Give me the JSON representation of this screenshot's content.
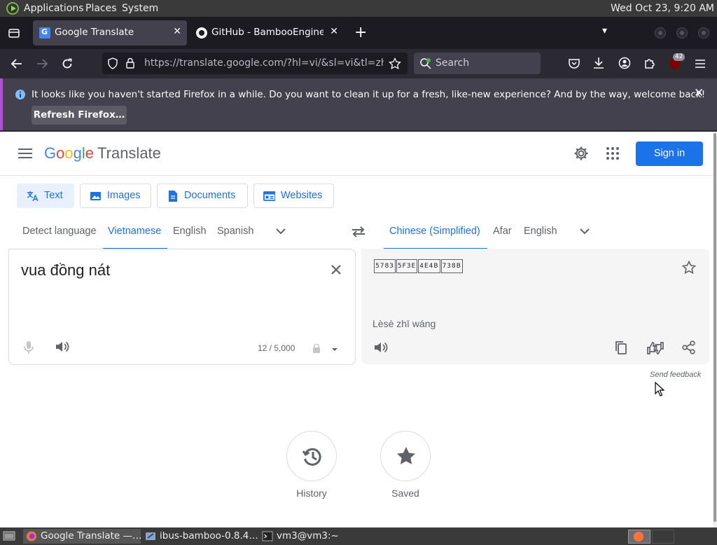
{
  "top_panel": {
    "menus": [
      "Applications",
      "Places",
      "System"
    ],
    "clock": "Wed Oct 23,  9:20 AM"
  },
  "browser": {
    "tabs": [
      {
        "title": "Google Translate",
        "active": true
      },
      {
        "title": "GitHub - BambooEngine/ibu",
        "active": false
      }
    ],
    "url": "https://translate.google.com/?hl=vi/&sl=vi&tl=zh-CN&",
    "search_placeholder": "Search",
    "extension_badge": "42",
    "notification": {
      "message": "It looks like you haven't started Firefox in a while. Do you want to clean it up for a fresh, like-new experience? And by the way, welcome back!",
      "button": "Refresh Firefox…"
    }
  },
  "translate": {
    "logo_letters": [
      "G",
      "o",
      "o",
      "g",
      "l",
      "e"
    ],
    "product": "Translate",
    "sign_in": "Sign in",
    "modes": [
      {
        "label": "Text",
        "selected": true
      },
      {
        "label": "Images",
        "selected": false
      },
      {
        "label": "Documents",
        "selected": false
      },
      {
        "label": "Websites",
        "selected": false
      }
    ],
    "source_languages": [
      "Detect language",
      "Vietnamese",
      "English",
      "Spanish"
    ],
    "source_selected": "Vietnamese",
    "target_languages": [
      "Chinese (Simplified)",
      "Afar",
      "English"
    ],
    "target_selected": "Chinese (Simplified)",
    "source_text": "vua đồng nát",
    "char_count": "12 / 5,000",
    "target_glyphs": [
      "5783",
      "5F3E",
      "4E4B",
      "738B"
    ],
    "romanization": "Lèsè zhī wáng",
    "send_feedback": "Send feedback",
    "history_label": "History",
    "saved_label": "Saved"
  },
  "taskbar": {
    "tasks": [
      {
        "label": "Google Translate —…",
        "active": true
      },
      {
        "label": "ibus-bamboo-0.8.4…",
        "active": false
      },
      {
        "label": "vm3@vm3:~",
        "active": false
      }
    ]
  },
  "colors": {
    "accent_blue": "#1a73e8",
    "firefox_dark": "#1c1b22",
    "notification_accent": "#b04fd9"
  }
}
